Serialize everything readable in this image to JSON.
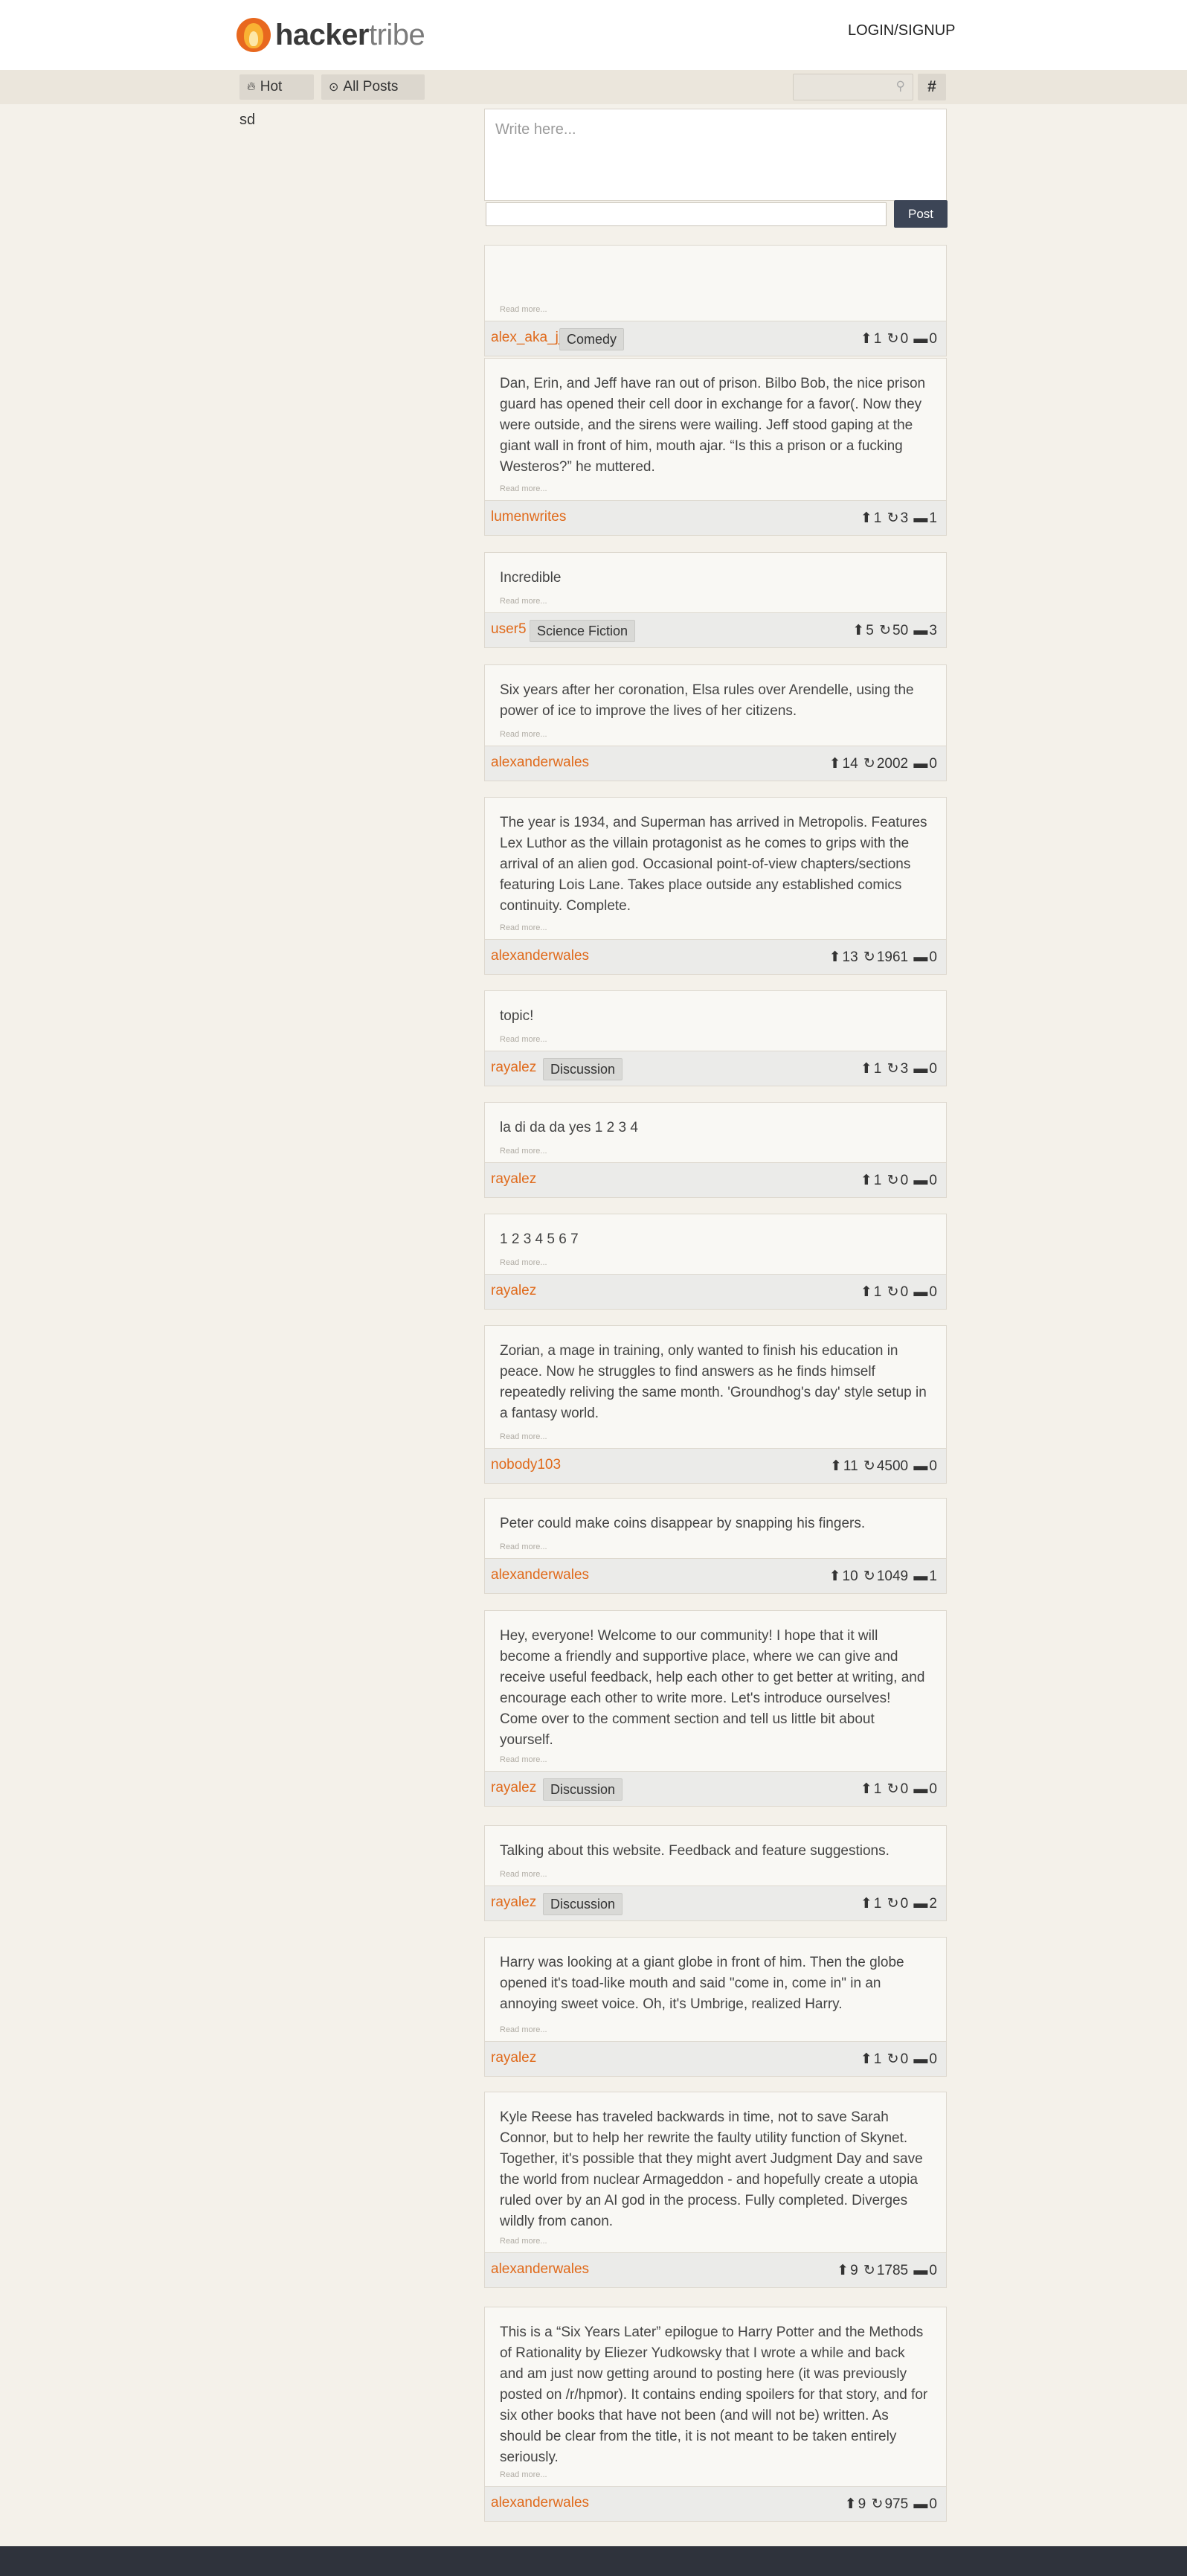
{
  "header": {
    "logo_bold": "hacker",
    "logo_light": "tribe",
    "login_label": "LOGIN/SIGNUP"
  },
  "nav": {
    "hot_label": "Hot",
    "all_posts_label": "All Posts",
    "hash_label": "#"
  },
  "sidebar": {
    "text": "sd"
  },
  "compose": {
    "placeholder": "Write here...",
    "title_value": "",
    "post_label": "Post"
  },
  "read_more_label": "Read more...",
  "icons": {
    "upvote": "arrow-up-icon",
    "reblog": "refresh-icon",
    "comment": "comment-icon"
  },
  "colors": {
    "accent": "#e06a1b",
    "button": "#3c4556",
    "footer": "#2f333c"
  },
  "posts": [
    {
      "body": "",
      "author": "alex_aka_jj",
      "tag": "Comedy",
      "upvotes": "1",
      "reposts": "0",
      "comments": "0"
    },
    {
      "body": "Dan, Erin, and Jeff have ran out of prison. Bilbo Bob, the nice prison guard has opened their cell door in exchange for a favor(. Now they were outside, and the sirens were wailing. Jeff stood gaping at the giant wall in front of him, mouth ajar. “Is this a prison or a fucking Westeros?” he muttered.",
      "author": "lumenwrites",
      "tag": "",
      "upvotes": "1",
      "reposts": "3",
      "comments": "1"
    },
    {
      "body": "Incredible",
      "author": "user5",
      "tag": "Science Fiction",
      "upvotes": "5",
      "reposts": "50",
      "comments": "3"
    },
    {
      "body": "Six years after her coronation, Elsa rules over Arendelle, using the power of ice to improve the lives of her citizens.",
      "author": "alexanderwales",
      "tag": "",
      "upvotes": "14",
      "reposts": "2002",
      "comments": "0"
    },
    {
      "body": "The year is 1934, and Superman has arrived in Metropolis. Features Lex Luthor as the villain protagonist as he comes to grips with the arrival of an alien god. Occasional point-of-view chapters/sections featuring Lois Lane. Takes place outside any established comics continuity. Complete.",
      "author": "alexanderwales",
      "tag": "",
      "upvotes": "13",
      "reposts": "1961",
      "comments": "0"
    },
    {
      "body": "topic!",
      "author": "rayalez",
      "tag": "Discussion",
      "upvotes": "1",
      "reposts": "3",
      "comments": "0"
    },
    {
      "body": "la di da da yes 1 2 3 4",
      "author": "rayalez",
      "tag": "",
      "upvotes": "1",
      "reposts": "0",
      "comments": "0"
    },
    {
      "body": "1 2 3 4 5 6 7",
      "author": "rayalez",
      "tag": "",
      "upvotes": "1",
      "reposts": "0",
      "comments": "0"
    },
    {
      "body": "Zorian, a mage in training, only wanted to finish his education in peace. Now he struggles to find answers as he finds himself repeatedly reliving the same month. 'Groundhog's day' style setup in a fantasy world.",
      "author": "nobody103",
      "tag": "",
      "upvotes": "11",
      "reposts": "4500",
      "comments": "0"
    },
    {
      "body": "Peter could make coins disappear by snapping his fingers.",
      "author": "alexanderwales",
      "tag": "",
      "upvotes": "10",
      "reposts": "1049",
      "comments": "1"
    },
    {
      "body": "Hey, everyone! Welcome to our community! I hope that it will become a friendly and supportive place, where we can give and receive useful feedback, help each other to get better at writing, and encourage each other to write more. Let's introduce ourselves! Come over to the comment section and tell us little bit about yourself.",
      "author": "rayalez",
      "tag": "Discussion",
      "upvotes": "1",
      "reposts": "0",
      "comments": "0"
    },
    {
      "body": "Talking about this website. Feedback and feature suggestions.",
      "author": "rayalez",
      "tag": "Discussion",
      "upvotes": "1",
      "reposts": "0",
      "comments": "2"
    },
    {
      "body": "Harry was looking at a giant globe in front of him. Then the globe opened it's toad-like mouth and said \"come in, come in\" in an annoying sweet voice. Oh, it's Umbrige, realized Harry.",
      "author": "rayalez",
      "tag": "",
      "upvotes": "1",
      "reposts": "0",
      "comments": "0"
    },
    {
      "body": "Kyle Reese has traveled backwards in time, not to save Sarah Connor, but to help her rewrite the faulty utility function of Skynet. Together, it's possible that they might avert Judgment Day and save the world from nuclear Armageddon - and hopefully create a utopia ruled over by an AI god in the process. Fully completed. Diverges wildly from canon.",
      "author": "alexanderwales",
      "tag": "",
      "upvotes": "9",
      "reposts": "1785",
      "comments": "0"
    },
    {
      "body": "This is a “Six Years Later” epilogue to Harry Potter and the Methods of Rationality by Eliezer Yudkowsky that I wrote a while and back and am just now getting around to posting here (it was previously posted on /r/hpmor). It contains ending spoilers for that story, and for six other books that have not been (and will not be) written. As should be clear from the title, it is not meant to be taken entirely seriously.",
      "author": "alexanderwales",
      "tag": "",
      "upvotes": "9",
      "reposts": "975",
      "comments": "0"
    }
  ]
}
